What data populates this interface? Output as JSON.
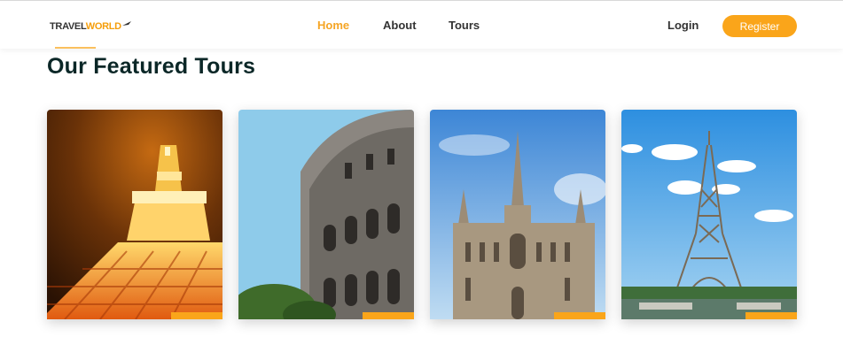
{
  "header": {
    "logo": {
      "part1": "TRAVEL",
      "part2": "WORLD"
    },
    "nav": [
      {
        "label": "Home",
        "active": true
      },
      {
        "label": "About",
        "active": false
      },
      {
        "label": "Tours",
        "active": false
      }
    ],
    "login_label": "Login",
    "register_label": "Register"
  },
  "section": {
    "title": "Our Featured Tours"
  },
  "tours": [
    {
      "image": "tokyo-tower-night"
    },
    {
      "image": "colosseum"
    },
    {
      "image": "gothic-cathedral"
    },
    {
      "image": "eiffel-tower"
    }
  ],
  "colors": {
    "accent": "#faa51a",
    "title": "#0b2727",
    "text": "#333333"
  }
}
